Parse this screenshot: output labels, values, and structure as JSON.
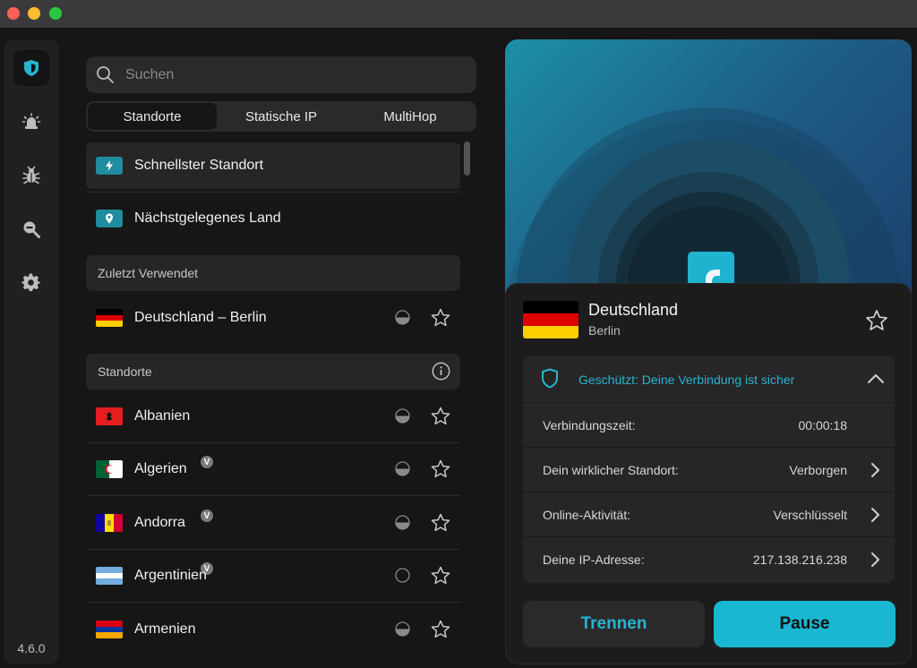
{
  "window": {
    "controls": [
      "close",
      "minimize",
      "zoom"
    ]
  },
  "sidebar": {
    "items": [
      {
        "icon": "shield-icon",
        "active": true
      },
      {
        "icon": "alert-light-icon",
        "active": false
      },
      {
        "icon": "bug-icon",
        "active": false
      },
      {
        "icon": "search-zoom-icon",
        "active": false
      },
      {
        "icon": "gear-icon",
        "active": false
      }
    ],
    "version": "4.6.0"
  },
  "search": {
    "placeholder": "Suchen"
  },
  "tabs": [
    {
      "label": "Standorte",
      "active": true
    },
    {
      "label": "Statische IP",
      "active": false
    },
    {
      "label": "MultiHop",
      "active": false
    }
  ],
  "quick": {
    "fastest": "Schnellster Standort",
    "nearest": "Nächstgelegenes Land"
  },
  "recent": {
    "header": "Zuletzt Verwendet",
    "items": [
      {
        "label": "Deutschland – Berlin"
      }
    ]
  },
  "locations": {
    "header": "Standorte",
    "items": [
      {
        "label": "Albanien",
        "virtual": false
      },
      {
        "label": "Algerien",
        "virtual": true,
        "virtual_badge": "V"
      },
      {
        "label": "Andorra",
        "virtual": true,
        "virtual_badge": "V"
      },
      {
        "label": "Argentinien",
        "virtual": true,
        "virtual_badge": "V"
      },
      {
        "label": "Armenien",
        "virtual": false
      }
    ]
  },
  "connection": {
    "country": "Deutschland",
    "city": "Berlin",
    "status": "Geschützt: Deine Verbindung ist sicher",
    "details": [
      {
        "label": "Verbindungszeit:",
        "value": "00:00:18",
        "has_chevron": false
      },
      {
        "label": "Dein wirklicher Standort:",
        "value": "Verborgen",
        "has_chevron": true
      },
      {
        "label": "Online-Aktivität:",
        "value": "Verschlüsselt",
        "has_chevron": true
      },
      {
        "label": "Deine IP-Adresse:",
        "value": "217.138.216.238",
        "has_chevron": true
      }
    ],
    "disconnect_label": "Trennen",
    "pause_label": "Pause"
  },
  "colors": {
    "accent": "#1ab7d2",
    "status_text": "#27b4cf",
    "background": "#161616",
    "panel": "#262627"
  }
}
